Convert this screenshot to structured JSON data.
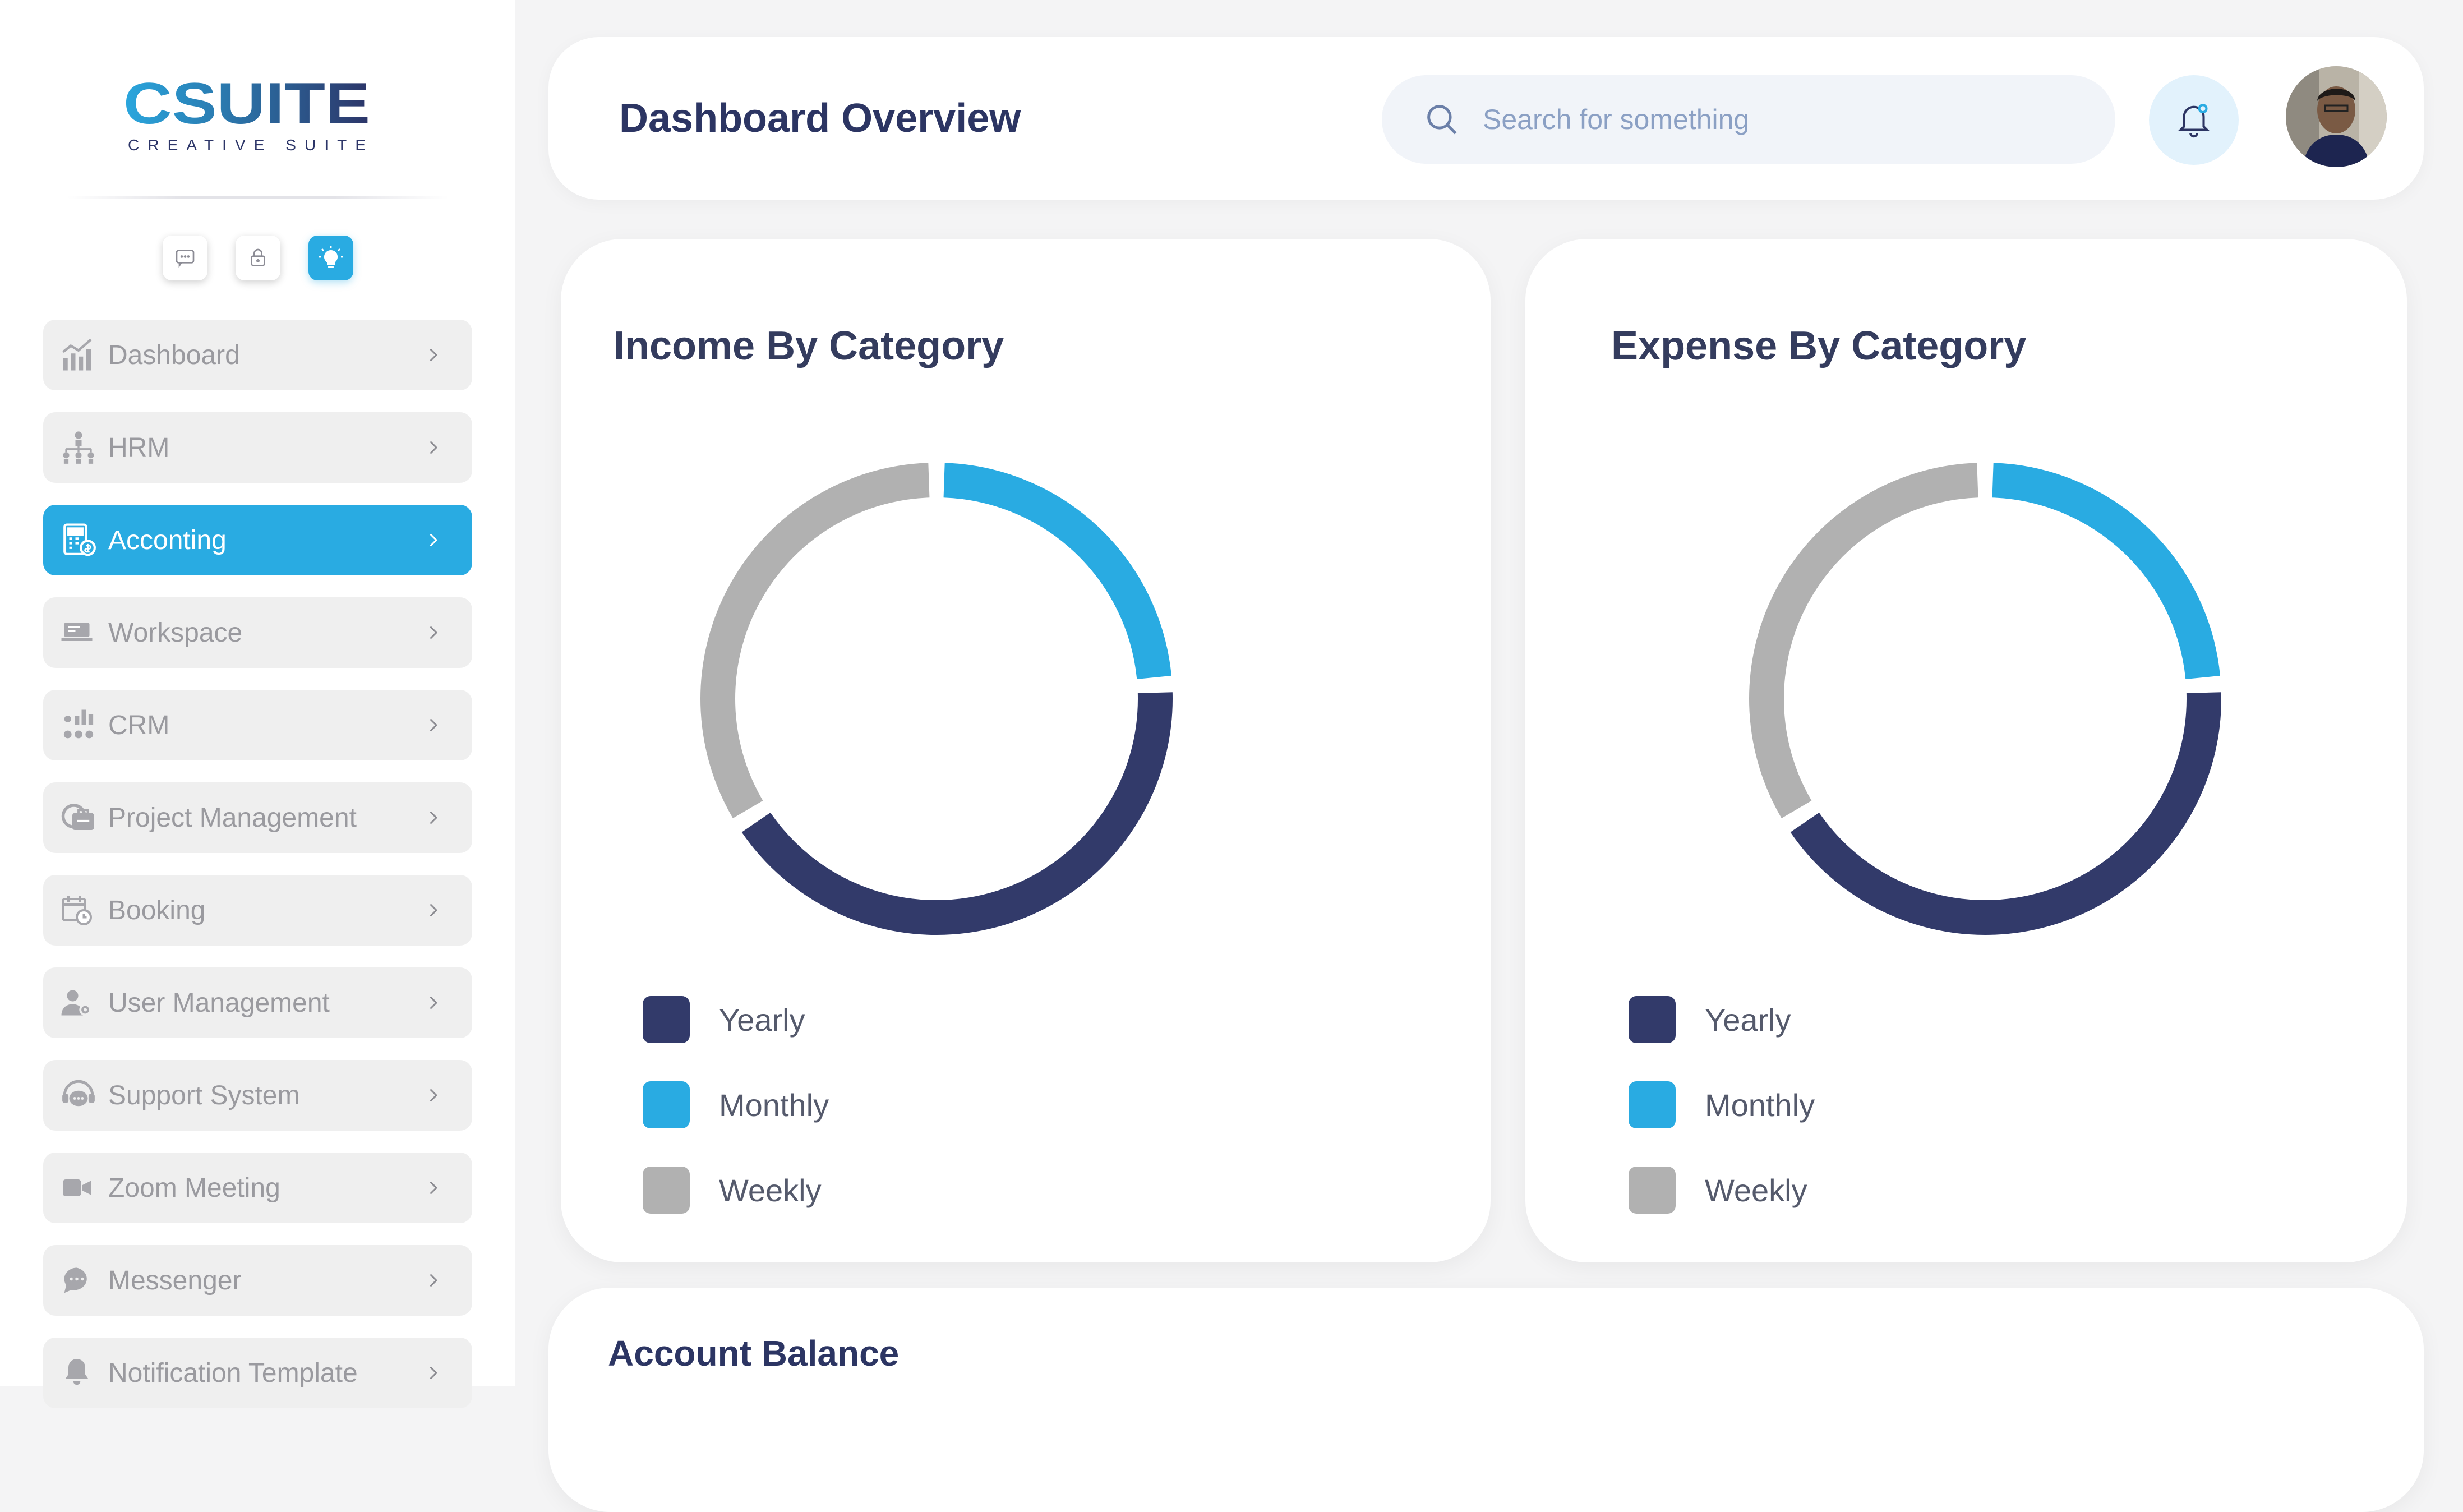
{
  "brand": {
    "name": "CSUITE",
    "tagline": "CREATIVE SUITE"
  },
  "sidebar": {
    "quick_actions": [
      {
        "icon": "chat-icon"
      },
      {
        "icon": "lock-icon"
      },
      {
        "icon": "lightbulb-icon",
        "active": true
      }
    ],
    "items": [
      {
        "label": "Dashboard",
        "icon": "chart-icon"
      },
      {
        "label": "HRM",
        "icon": "org-chart-icon"
      },
      {
        "label": "Acconting",
        "icon": "calculator-icon",
        "active": true
      },
      {
        "label": "Workspace",
        "icon": "workspace-icon"
      },
      {
        "label": "CRM",
        "icon": "crm-icon"
      },
      {
        "label": "Project Management",
        "icon": "project-icon"
      },
      {
        "label": "Booking",
        "icon": "calendar-icon"
      },
      {
        "label": "User Management",
        "icon": "user-settings-icon"
      },
      {
        "label": "Support System",
        "icon": "support-icon"
      },
      {
        "label": "Zoom Meeting",
        "icon": "video-icon"
      },
      {
        "label": "Messenger",
        "icon": "message-icon"
      },
      {
        "label": "Notification Template",
        "icon": "notification-icon"
      }
    ]
  },
  "header": {
    "title": "Dashboard Overview",
    "search_placeholder": "Search for something"
  },
  "colors": {
    "accent": "#29abe2",
    "navy": "#323a6a",
    "gray": "#b1b1b1"
  },
  "income": {
    "title": "Income By Category",
    "legend": [
      "Yearly",
      "Monthly",
      "Weekly"
    ]
  },
  "expense": {
    "title": "Expense By Category",
    "legend": [
      "Yearly",
      "Monthly",
      "Weekly"
    ]
  },
  "chart_data": [
    {
      "type": "pie",
      "title": "Income By Category",
      "categories": [
        "Yearly",
        "Monthly",
        "Weekly"
      ],
      "values": [
        42,
        24,
        34
      ],
      "colors": [
        "#323a6a",
        "#29abe2",
        "#b1b1b1"
      ]
    },
    {
      "type": "pie",
      "title": "Expense By Category",
      "categories": [
        "Yearly",
        "Monthly",
        "Weekly"
      ],
      "values": [
        42,
        24,
        34
      ],
      "colors": [
        "#323a6a",
        "#29abe2",
        "#b1b1b1"
      ]
    }
  ],
  "balance": {
    "title": "Account Balance"
  }
}
